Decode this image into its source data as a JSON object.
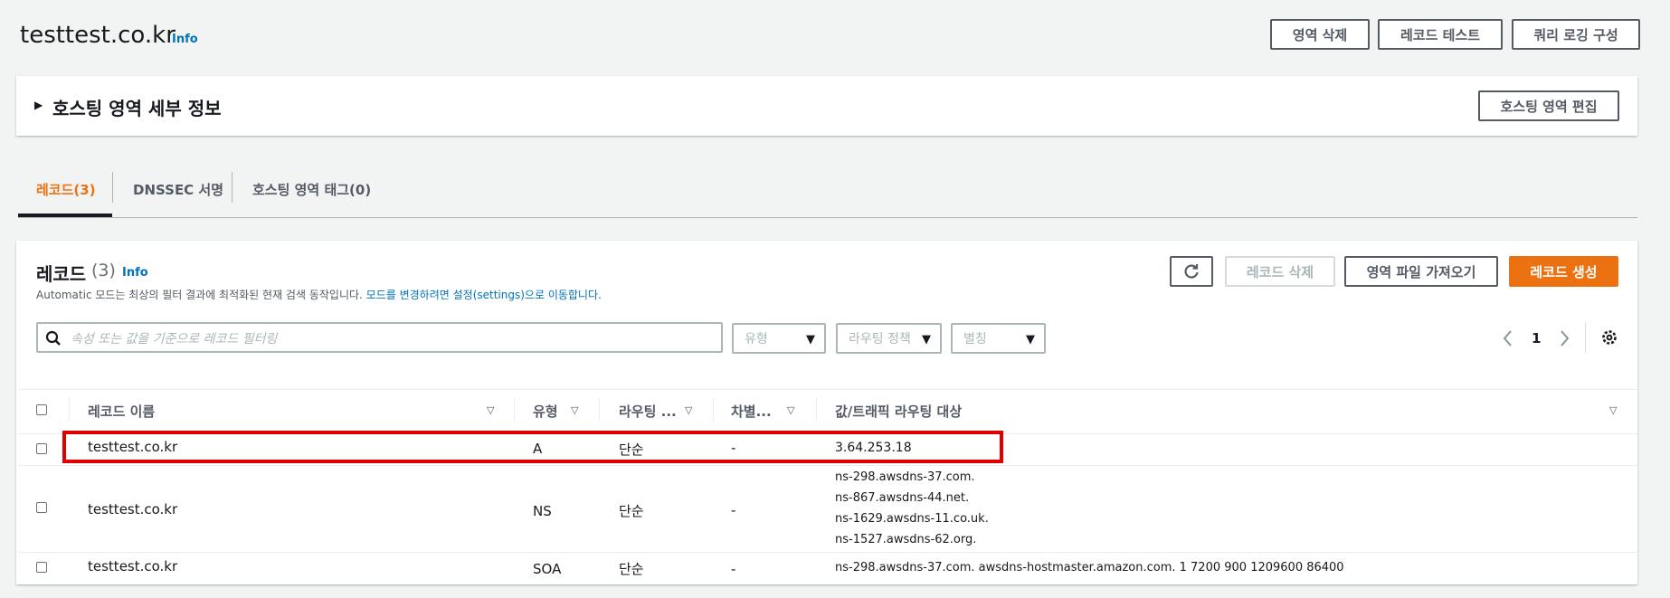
{
  "header": {
    "title": "testtest.co.kr",
    "info": "Info",
    "delete_zone": "영역 삭제",
    "test_record": "레코드 테스트",
    "query_logging": "쿼리 로깅 구성"
  },
  "details": {
    "toggle": "▶",
    "title": "호스팅 영역 세부 정보",
    "edit": "호스팅 영역 편집"
  },
  "tabs": [
    {
      "label": "레코드(3)",
      "active": true
    },
    {
      "label": "DNSSEC 서명"
    },
    {
      "label": "호스팅 영역 태그(0)"
    }
  ],
  "records_panel": {
    "title": "레코드",
    "count": "(3)",
    "info": "Info",
    "desc": "Automatic 모드는 최상의 필터 결과에 최적화된 현재 검색 동작입니다.",
    "desc_link": "모드를 변경하려면 설정(settings)으로 이동합니다.",
    "delete": "레코드 삭제",
    "import": "영역 파일 가져오기",
    "create": "레코드 생성",
    "search_placeholder": "속성 또는 값을 기준으로 레코드 필터링",
    "filter_type": "유형",
    "filter_policy": "라우팅 정책",
    "filter_alias": "별칭",
    "page": "1"
  },
  "table": {
    "columns": [
      "레코드 이름",
      "유형",
      "라우팅 ...",
      "차별...",
      "값/트래픽 라우팅 대상"
    ],
    "rows": [
      {
        "name": "testtest.co.kr",
        "type": "A",
        "policy": "단순",
        "diff": "-",
        "values": [
          "3.64.253.18"
        ]
      },
      {
        "name": "testtest.co.kr",
        "type": "NS",
        "policy": "단순",
        "diff": "-",
        "values": [
          "ns-298.awsdns-37.com.",
          "ns-867.awsdns-44.net.",
          "ns-1629.awsdns-11.co.uk.",
          "ns-1527.awsdns-62.org."
        ]
      },
      {
        "name": "testtest.co.kr",
        "type": "SOA",
        "policy": "단순",
        "diff": "-",
        "values": [
          "ns-298.awsdns-37.com. awsdns-hostmaster.amazon.com. 1 7200 900 1209600 86400"
        ]
      }
    ]
  },
  "colors": {
    "accent": "#ec7211",
    "link": "#0073bb",
    "highlight": "#e00000"
  },
  "icons": [
    "refresh-icon",
    "search-icon",
    "chevron-left-icon",
    "chevron-right-icon",
    "settings-gear-icon",
    "sort-caret-icon",
    "caret-down-icon"
  ]
}
